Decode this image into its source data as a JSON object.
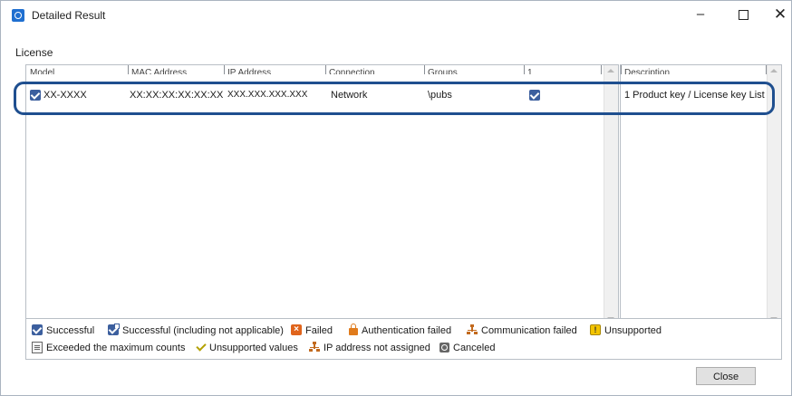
{
  "window": {
    "title": "Detailed Result",
    "min_glyph": "–",
    "close_glyph": "✕"
  },
  "section_label": "License",
  "grid": {
    "columns": [
      "Model",
      "MAC Address",
      "IP Address",
      "Connection",
      "Groups",
      "1"
    ],
    "rows": [
      {
        "checked": true,
        "model": "XX-XXXX",
        "mac": "XX:XX:XX:XX:XX:XX",
        "ip": "XXX.XXX.XXX.XXX",
        "connection": "Network",
        "group": "\\pubs",
        "col1_checked": true
      }
    ]
  },
  "description_panel": {
    "header": "Description",
    "text": "1 Product key / License key List"
  },
  "legend": [
    {
      "icon": "successful-icon",
      "label": "Successful"
    },
    {
      "icon": "successful-na-icon",
      "label": "Successful (including not applicable)"
    },
    {
      "icon": "failed-icon",
      "label": "Failed"
    },
    {
      "icon": "auth-failed-icon",
      "label": "Authentication failed"
    },
    {
      "icon": "comm-failed-icon",
      "label": "Communication failed"
    },
    {
      "icon": "unsupported-icon",
      "label": "Unsupported"
    },
    {
      "icon": "exceeded-icon",
      "label": "Exceeded the maximum counts"
    },
    {
      "icon": "unsupported-values-icon",
      "label": "Unsupported values"
    },
    {
      "icon": "ip-not-assigned-icon",
      "label": "IP address not assigned"
    },
    {
      "icon": "canceled-icon",
      "label": "Canceled"
    }
  ],
  "buttons": {
    "close": "Close"
  },
  "colors": {
    "accent": "#1f4f8f",
    "checkbox": "#3c5f9e",
    "failed": "#e0641c",
    "unsupported": "#f3c400"
  }
}
